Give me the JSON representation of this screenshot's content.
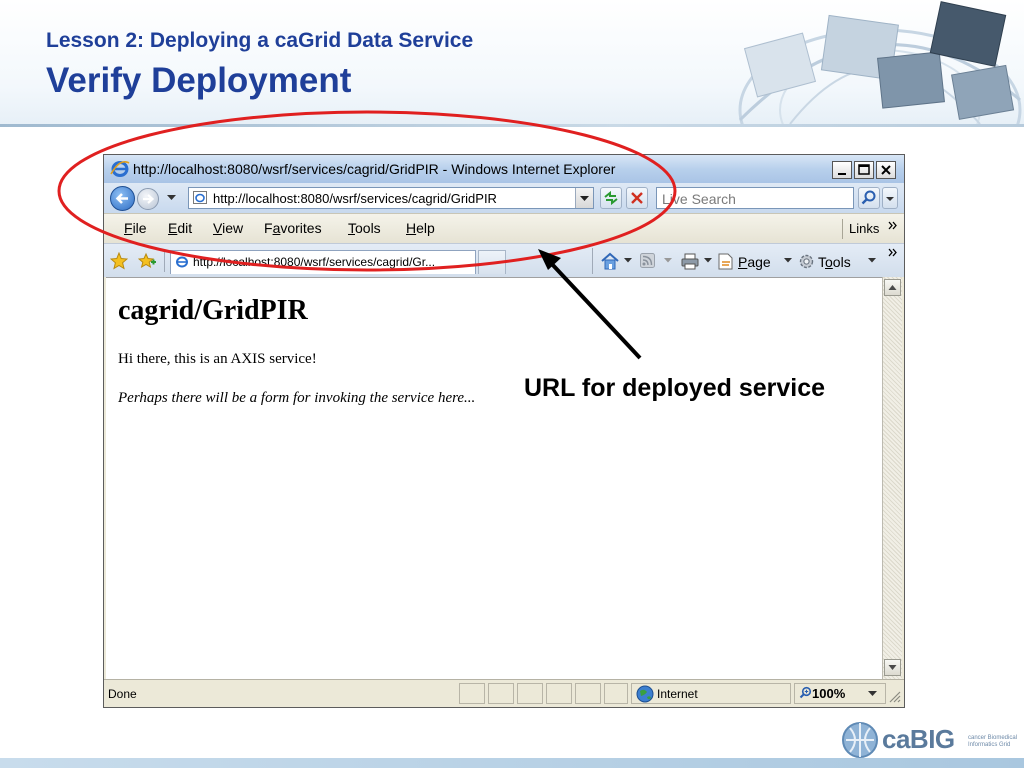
{
  "slide": {
    "lesson_title": "Lesson 2: Deploying a caGrid Data Service",
    "title": "Verify Deployment",
    "annotation": "URL for deployed service",
    "logo_text": "caBIG",
    "logo_tagline": "cancer Biomedical Informatics Grid"
  },
  "browser": {
    "window_title": "http://localhost:8080/wsrf/services/cagrid/GridPIR - Windows Internet Explorer",
    "address": "http://localhost:8080/wsrf/services/cagrid/GridPIR",
    "search_placeholder": "Live Search",
    "menu": [
      "File",
      "Edit",
      "View",
      "Favorites",
      "Tools",
      "Help"
    ],
    "links_label": "Links",
    "tab_title": "http://localhost:8080/wsrf/services/cagrid/Gr...",
    "page_label": "Page",
    "tools_label": "Tools",
    "status_text": "Done",
    "zone_text": "Internet",
    "zoom": "100%"
  },
  "page": {
    "heading": "cagrid/GridPIR",
    "line1": "Hi there, this is an AXIS service!",
    "line2": "Perhaps there will be a form for invoking the service here..."
  },
  "colors": {
    "title_blue": "#1f3f99",
    "annotation_red": "#e02020",
    "ie_logo_blue": "#2a6fd0"
  },
  "icons": {
    "back": "back-arrow-icon",
    "forward": "forward-arrow-icon",
    "refresh": "refresh-icon",
    "stop": "stop-icon",
    "search": "search-icon",
    "favorites": "favorites-star-icon",
    "home": "home-icon",
    "rss": "rss-icon",
    "print": "print-icon",
    "page": "page-icon",
    "tools": "gear-icon",
    "globe": "globe-icon"
  }
}
